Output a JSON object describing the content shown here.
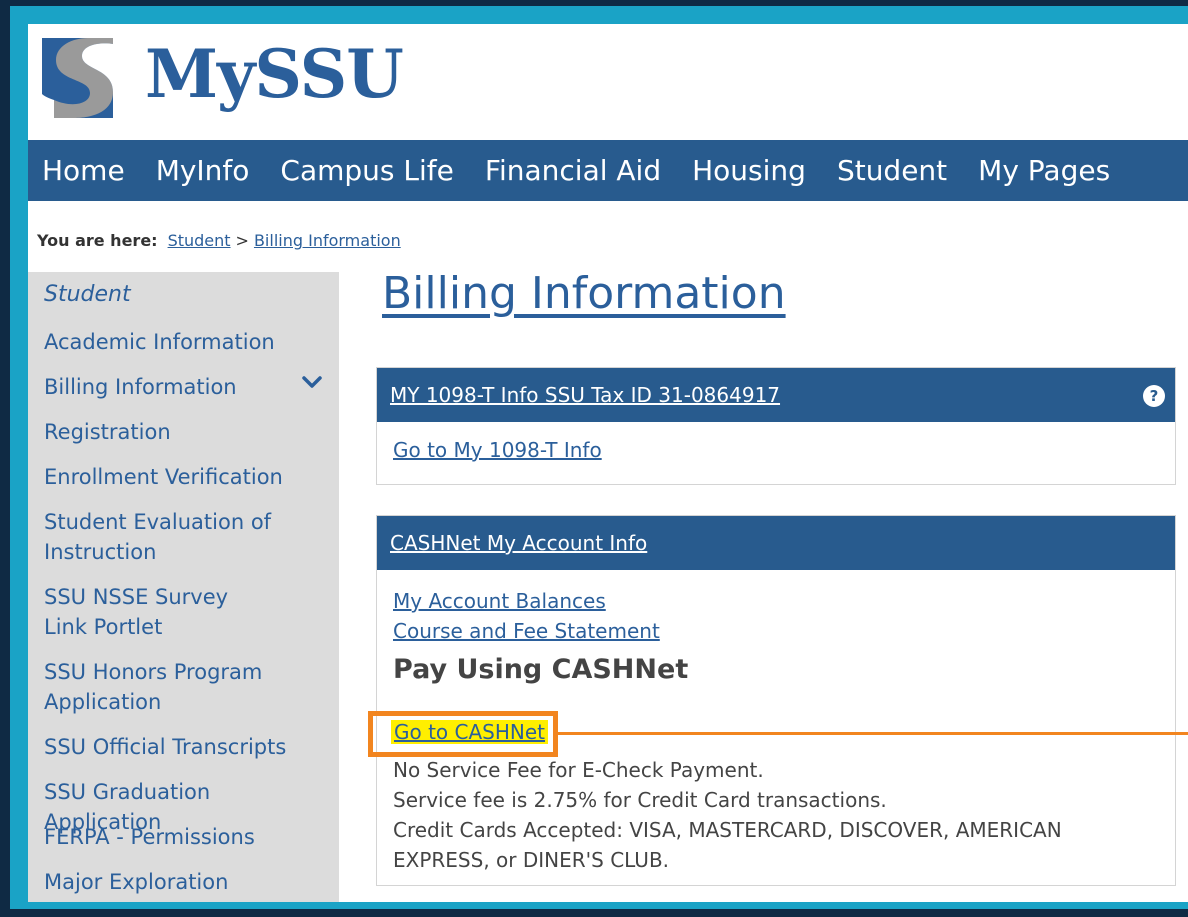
{
  "header": {
    "logo_text": "MySSU"
  },
  "nav": {
    "items": [
      "Home",
      "MyInfo",
      "Campus Life",
      "Financial Aid",
      "Housing",
      "Student",
      "My Pages"
    ]
  },
  "breadcrumb": {
    "label": "You are here:",
    "items": [
      "Student",
      "Billing Information"
    ],
    "separator": ">"
  },
  "sidebar": {
    "title": "Student",
    "items": [
      "Academic Information",
      "Billing Information",
      "Registration",
      "Enrollment Verification",
      "Student Evaluation of Instruction",
      "SSU NSSE Survey Link Portlet",
      "SSU Honors Program Application",
      "SSU Official Transcripts",
      "SSU Graduation Application",
      "FERPA - Permissions",
      "Major Exploration"
    ]
  },
  "main": {
    "title": "Billing Information",
    "panel1": {
      "header": "MY 1098-T Info SSU Tax ID 31-0864917",
      "link": "Go to My 1098-T Info"
    },
    "panel2": {
      "header": "CASHNet My Account Info",
      "links": [
        "My Account Balances",
        "Course and Fee Statement"
      ],
      "pay_heading": "Pay Using CASHNet",
      "cashnet_link": "Go to CASHNet",
      "notes": [
        "No Service Fee for E-Check Payment.",
        "Service fee is 2.75% for Credit Card transactions.",
        "Credit Cards Accepted: VISA, MASTERCARD, DISCOVER, AMERICAN EXPRESS, or DINER'S CLUB."
      ]
    }
  },
  "colors": {
    "brand_blue": "#285b8e",
    "link_blue": "#2b5f9b",
    "highlight": "#ffef00",
    "callout": "#f2851f",
    "frame": "#1aa3c6"
  },
  "icons": {
    "logo": "ssu-s-logo-icon",
    "expand": "chevron-down-icon",
    "help": "help-circle-icon"
  }
}
